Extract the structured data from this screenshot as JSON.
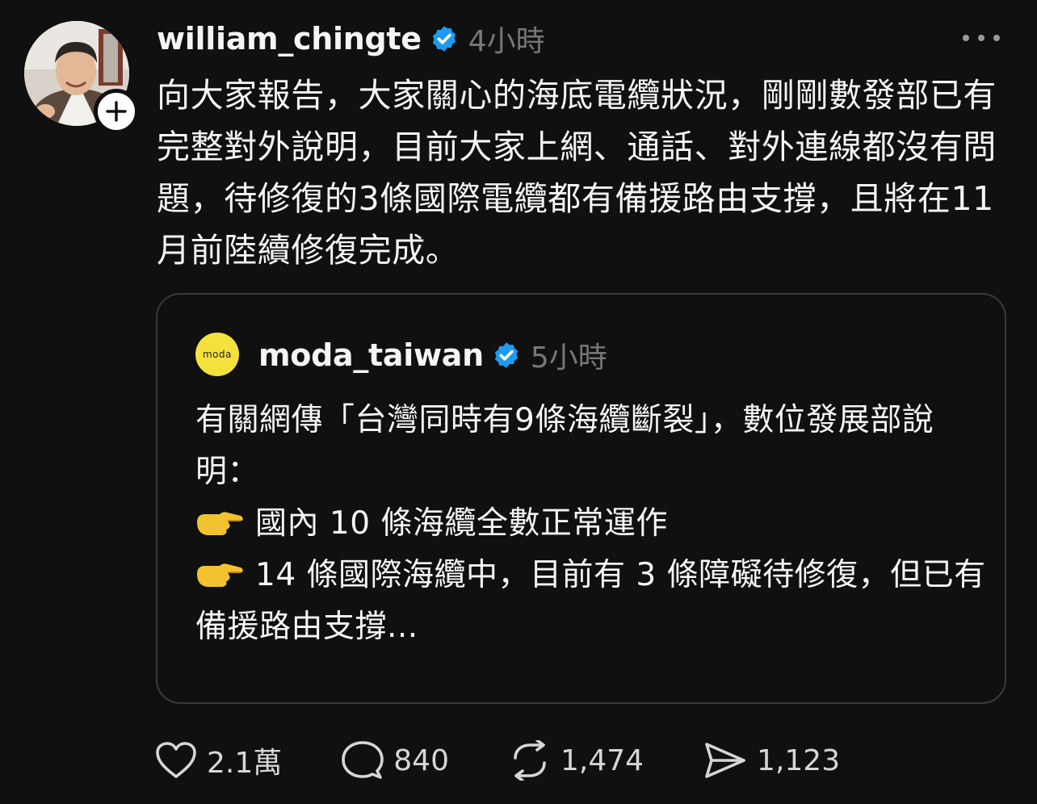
{
  "post": {
    "username": "william_chingte",
    "timestamp": "4小時",
    "text": "向大家報告，大家關心的海底電纜狀況，剛剛數發部已有完整對外說明，目前大家上網、通話、對外連線都沒有問題，待修復的3條國際電纜都有備援路由支撐，且將在11月前陸續修復完成。"
  },
  "quote": {
    "username": "moda_taiwan",
    "timestamp": "5小時",
    "avatar_text": "moda",
    "avatar_color": "#f5e13c",
    "line1": "有關網傳「台灣同時有9條海纜斷裂」，數位發展部說明：",
    "line2": "國內 10 條海纜全數正常運作",
    "line3": "14 條國際海纜中，目前有 3 條障礙待修復，但已有備援路由支撐..."
  },
  "actions": {
    "likes": "2.1萬",
    "comments": "840",
    "reposts": "1,474",
    "shares": "1,123"
  },
  "colors": {
    "background": "#101010",
    "verified": "#1d9bf0",
    "muted": "#777777"
  }
}
